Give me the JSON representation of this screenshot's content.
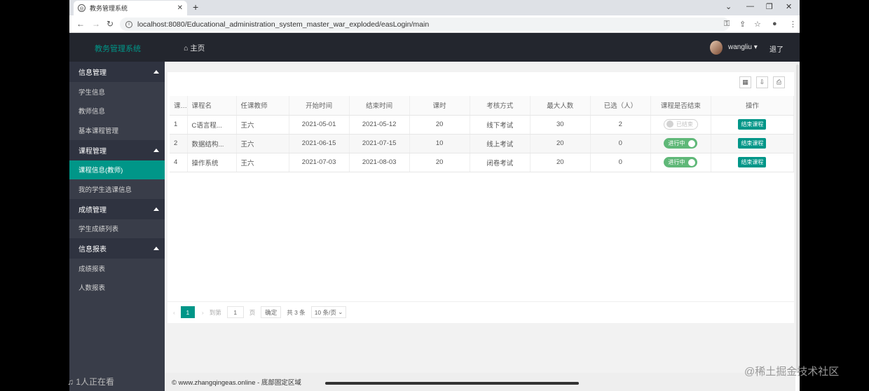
{
  "browser": {
    "tab_title": "教务管理系统",
    "url": "localhost:8080/Educational_administration_system_master_war_exploded/easLogin/main",
    "url_host": "localhost",
    "url_rest": ":8080/Educational_administration_system_master_war_exploded/easLogin/main"
  },
  "header": {
    "brand": "教务管理系统",
    "home": "主页",
    "user": "wangliu",
    "logout": "退了"
  },
  "sidebar": {
    "groups": [
      {
        "label": "信息管理",
        "items": [
          "学生信息",
          "教师信息",
          "基本课程管理"
        ]
      },
      {
        "label": "课程管理",
        "items": [
          "课程信息(教师)",
          "我的学生选课信息"
        ]
      },
      {
        "label": "成绩管理",
        "items": [
          "学生成绩列表"
        ]
      },
      {
        "label": "信息报表",
        "items": [
          "成绩报表",
          "人数报表"
        ]
      }
    ],
    "active_item": "课程信息(教师)"
  },
  "table": {
    "headers": [
      "课...",
      "课程名",
      "任课教师",
      "开始时间",
      "结束时间",
      "课时",
      "考核方式",
      "最大人数",
      "已选（人）",
      "课程是否结束",
      "操作"
    ],
    "rows": [
      {
        "id": "1",
        "name": "C语言程...",
        "teacher": "王六",
        "start": "2021-05-01",
        "end": "2021-05-12",
        "hours": "20",
        "exam": "线下考试",
        "max": "30",
        "selected": "2",
        "status": "已结束",
        "status_on": false,
        "action": "结束课程"
      },
      {
        "id": "2",
        "name": "数据结构...",
        "teacher": "王六",
        "start": "2021-06-15",
        "end": "2021-07-15",
        "hours": "10",
        "exam": "线上考试",
        "max": "20",
        "selected": "0",
        "status": "进行中",
        "status_on": true,
        "action": "结束课程"
      },
      {
        "id": "4",
        "name": "操作系统",
        "teacher": "王六",
        "start": "2021-07-03",
        "end": "2021-08-03",
        "hours": "20",
        "exam": "闭卷考试",
        "max": "20",
        "selected": "0",
        "status": "进行中",
        "status_on": true,
        "action": "结束课程"
      }
    ]
  },
  "pager": {
    "current": "1",
    "goto_label": "到第",
    "goto_value": "1",
    "page_unit": "页",
    "confirm": "确定",
    "total": "共 3 条",
    "page_size": "10 条/页"
  },
  "footer": {
    "text": "© www.zhangqingeas.online - 底部固定区域"
  },
  "overlays": {
    "viewers": "1人正在看",
    "watermark": "@稀土掘金技术社区"
  },
  "colors": {
    "accent": "#009688",
    "header_bg": "#23262e",
    "sidebar_bg": "#393d49",
    "toggle_on": "#5fb878"
  }
}
